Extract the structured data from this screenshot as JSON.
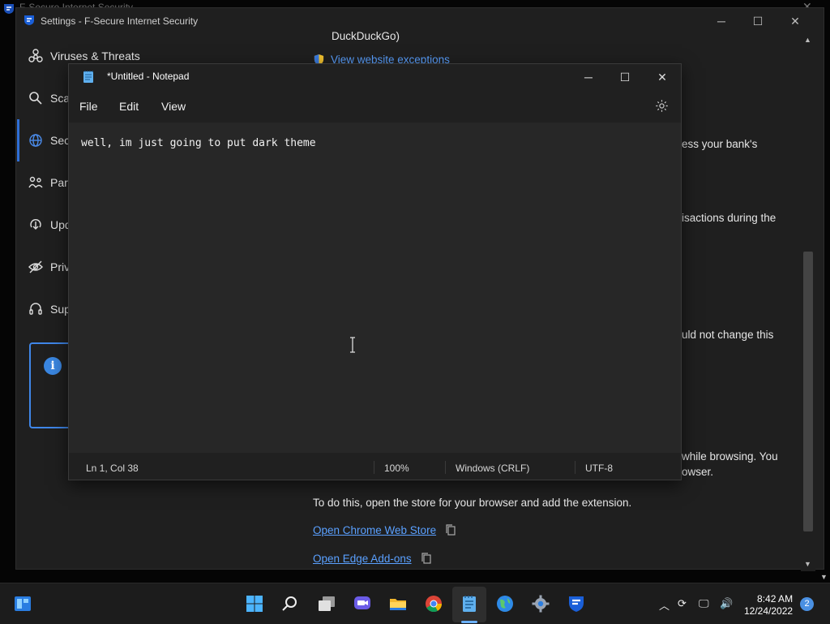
{
  "background_window": {
    "title": "F-Secure Internet Security"
  },
  "fsecure": {
    "title": "Settings - F-Secure Internet Security",
    "nav": [
      {
        "label": "Viruses & Threats",
        "icon": "biohazard-icon"
      },
      {
        "label": "Sca",
        "icon": "scan-icon"
      },
      {
        "label": "Sec",
        "icon": "globe-icon"
      },
      {
        "label": "Par",
        "icon": "family-icon"
      },
      {
        "label": "Upd",
        "icon": "update-icon"
      },
      {
        "label": "Priv",
        "icon": "eye-slash-icon"
      },
      {
        "label": "Sup",
        "icon": "headset-icon"
      }
    ],
    "content": {
      "duckduckgo": "DuckDuckGo)",
      "website_exceptions_link": "View website exceptions",
      "bank_fragment": "ess your bank's",
      "transactions_fragment": "isactions during the",
      "change_fragment": "uld not change this",
      "browsing_fragment_1": "while browsing. You",
      "browsing_fragment_2": "owser.",
      "store_instructions": "To do this, open the store for your browser and add the extension.",
      "chrome_store_link": "Open Chrome Web Store",
      "edge_addons_link": "Open Edge Add-ons"
    }
  },
  "notepad": {
    "title": "*Untitled - Notepad",
    "menu": {
      "file": "File",
      "edit": "Edit",
      "view": "View"
    },
    "text": "well, im just going to put dark theme",
    "status": {
      "position": "Ln 1, Col 38",
      "zoom": "100%",
      "line_ending": "Windows (CRLF)",
      "encoding": "UTF-8"
    }
  },
  "taskbar": {
    "time": "8:42 AM",
    "date": "12/24/2022",
    "notification_count": "2",
    "apps": [
      "start-icon",
      "search-icon",
      "task-view-icon",
      "chat-icon",
      "file-explorer-icon",
      "chrome-icon",
      "notepad-icon",
      "browser-globe-icon",
      "settings-gear-icon",
      "fsecure-icon"
    ]
  },
  "colors": {
    "accent": "#2f6fd6",
    "link": "#5aa0ff",
    "taskbar_active": "#6ab0ff"
  }
}
